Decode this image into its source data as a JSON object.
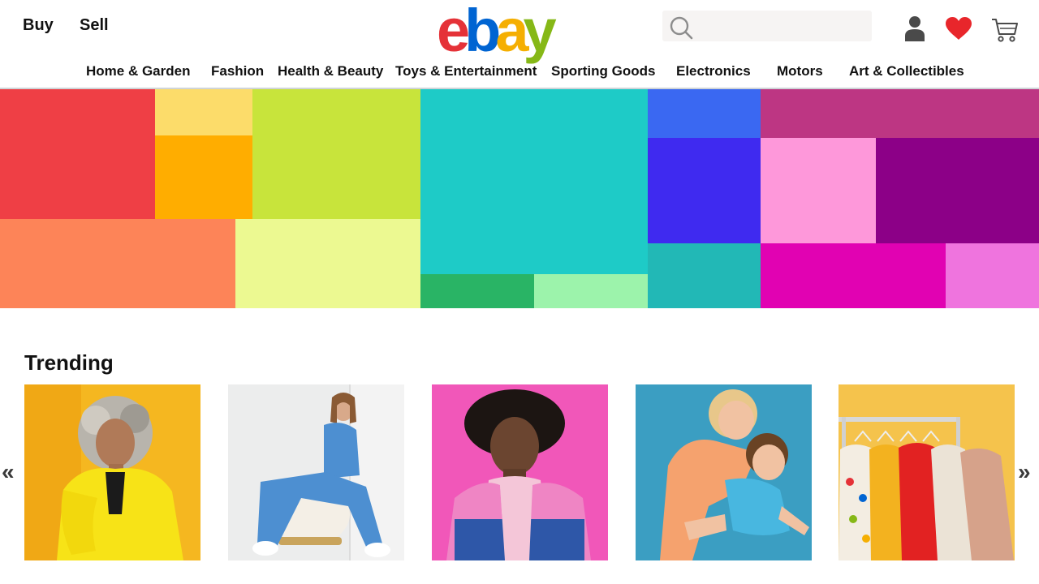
{
  "header": {
    "buy_label": "Buy",
    "sell_label": "Sell",
    "logo_letters": [
      {
        "char": "e",
        "color": "#e53238"
      },
      {
        "char": "b",
        "color": "#0064d2"
      },
      {
        "char": "a",
        "color": "#f5af02"
      },
      {
        "char": "y",
        "color": "#86b817"
      }
    ],
    "icons": [
      "search-icon",
      "user-icon",
      "heart-icon",
      "cart-icon"
    ],
    "heart_color": "#e8262b"
  },
  "nav": {
    "items": [
      "Home & Garden",
      "Fashion",
      "Health & Beauty",
      "Toys & Entertainment",
      "Sporting Goods",
      "Electronics",
      "Motors",
      "Art & Collectibles"
    ]
  },
  "banner": {
    "tile_colors": [
      "#ef3f45",
      "#fcdc6a",
      "#ffad00",
      "#c8e43b",
      "#fd8458",
      "#ecf991",
      "#1ecbc7",
      "#29b465",
      "#9cf3ab",
      "#3a68f2",
      "#bd3683",
      "#3f2af0",
      "#fe98da",
      "#8c0087",
      "#22b8b6",
      "#e102b2",
      "#ef74de"
    ]
  },
  "trending": {
    "title": "Trending",
    "cards": [
      {
        "subject": "woman-yellow-fur-coat",
        "bg": "#f5b720"
      },
      {
        "subject": "woman-blue-tracksuit",
        "bg": "#eceded"
      },
      {
        "subject": "man-pink-jacket",
        "bg": "#f157b9"
      },
      {
        "subject": "kids-playing-orange",
        "bg": "#3b9ec2"
      },
      {
        "subject": "sweaters-on-rack",
        "bg": "#f5c34c"
      }
    ],
    "prev_icon": "double-chevron-left-icon",
    "next_icon": "double-chevron-right-icon"
  }
}
